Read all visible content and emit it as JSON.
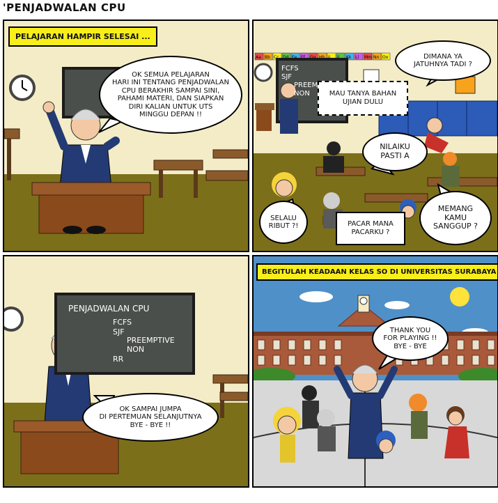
{
  "page": {
    "title": "'PENJADWALAN CPU"
  },
  "panel1": {
    "caption": "PELAJARAN HAMPIR SELESAI ...",
    "speech": "OK SEMUA PELAJARAN\nHARI INI TENTANG PENJADWALAN\nCPU BERAKHIR SAMPAI SINI,\nPAHAMI MATERI, DAN SIAPKAN\nDIRI KALIAN UNTUK UTS\nMINGGU DEPAN !!"
  },
  "panel2": {
    "alphabet": [
      "Aa",
      "Bb",
      "Cc",
      "Dd",
      "Ee",
      "Ff",
      "Gg",
      "Hh",
      "Ii",
      "Jj",
      "Kk",
      "Ll",
      "Mm",
      "Nn",
      "Oo"
    ],
    "board_lines": [
      "FCFS",
      "SJF",
      "PREEMPTIVE",
      "NON"
    ],
    "bubbles": {
      "dimana": "DIMANA YA\nJATUHNYA TADI ?",
      "ujian": "MAU TANYA BAHAN\nUJIAN DULU",
      "nilaiku": "NILAIKU\nPASTI A",
      "selalu": "SELALU\nRIBUT ?!",
      "pacar": "PACAR MANA\nPACARKU ?",
      "memang": "MEMANG\nKAMU\nSANGGUP ?"
    }
  },
  "panel3": {
    "board_title": "PENJADWALAN CPU",
    "board_items": [
      "FCFS",
      "SJF",
      "PREEMPTIVE",
      "NON",
      "RR"
    ],
    "speech": "OK SAMPAI JUMPA\nDI PERTEMUAN SELANJUTNYA\nBYE - BYE !!"
  },
  "panel4": {
    "caption": "BEGITULAH KEADAAN KELAS SO DI UNIVERSITAS SURABAYA",
    "speech": "THANK YOU\nFOR PLAYING !!\nBYE - BYE"
  },
  "colors": {
    "caption_yellow": "#f7ee1b",
    "classroom_wall": "#f3ecc6",
    "floor_olive": "#7c6f1a",
    "sky_blue": "#4f90c9",
    "suit_navy": "#233a74"
  }
}
